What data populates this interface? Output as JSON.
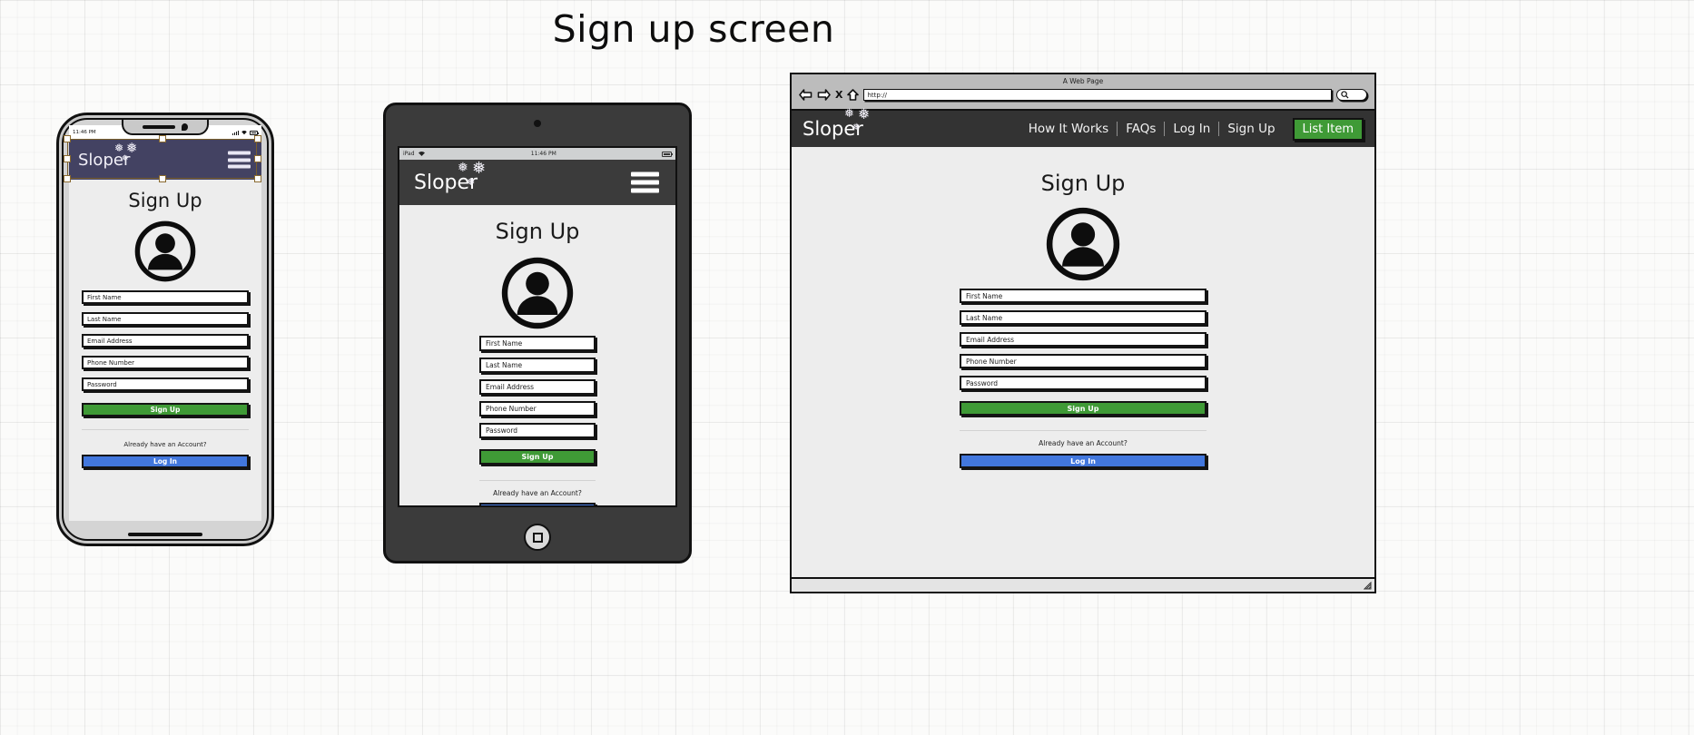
{
  "page": {
    "title": "Sign up screen"
  },
  "brand": {
    "name": "Sloper",
    "snowflake_glyph": "❅",
    "snowflake_small_glyph": "❅"
  },
  "form": {
    "heading": "Sign Up",
    "fields": [
      {
        "name": "first-name",
        "placeholder": "First Name"
      },
      {
        "name": "last-name",
        "placeholder": "Last Name"
      },
      {
        "name": "email-address",
        "placeholder": "Email Address"
      },
      {
        "name": "phone-number",
        "placeholder": "Phone Number"
      },
      {
        "name": "password",
        "placeholder": "Password"
      }
    ],
    "signup_button": "Sign Up",
    "account_hint": "Already have an Account?",
    "login_button": "Log In"
  },
  "phone": {
    "status_time": "11:46 PM"
  },
  "tablet": {
    "status_device": "iPad",
    "status_time": "11:46 PM",
    "wifi_glyph": "▼"
  },
  "browser": {
    "window_title": "A Web Page",
    "url_value": "http://",
    "icons": {
      "back": "back-arrow-icon",
      "forward": "forward-arrow-icon",
      "stop": "X",
      "home": "home-icon",
      "search": "search-icon"
    },
    "nav_links": [
      {
        "label": "How It Works"
      },
      {
        "label": "FAQs"
      },
      {
        "label": "Log In"
      },
      {
        "label": "Sign Up"
      }
    ],
    "cta_label": "List Item"
  },
  "colors": {
    "green": "#3f9a36",
    "blue": "#4277dd",
    "phone_navbar": "#434262",
    "dark_navbar": "#333333",
    "screen_bg": "#ededed"
  }
}
